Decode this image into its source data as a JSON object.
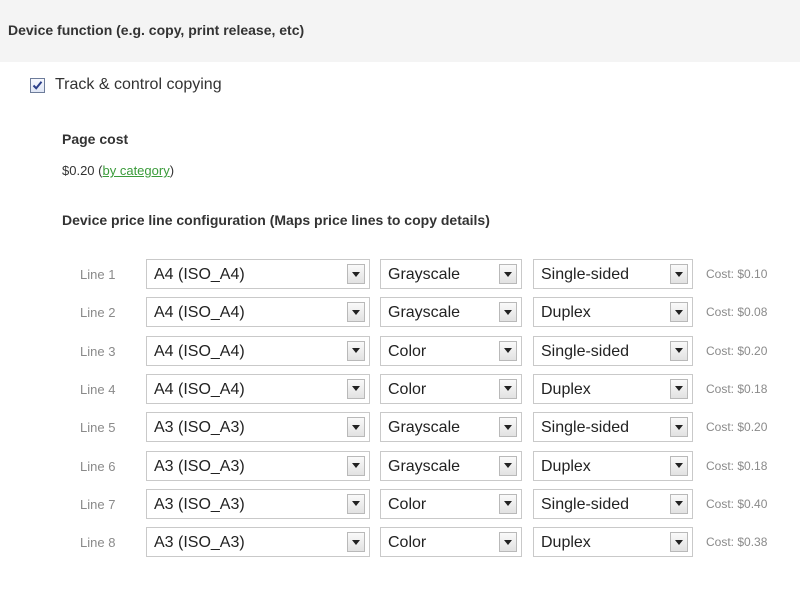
{
  "section": {
    "title": "Device function (e.g. copy, print release, etc)",
    "track_copying": {
      "label": "Track & control copying",
      "checked": true
    }
  },
  "page_cost": {
    "title": "Page cost",
    "amount": "$0.20",
    "link_label": "by category"
  },
  "price_config": {
    "title": "Device price line configuration (Maps price lines to copy details)",
    "lines": [
      {
        "label": "Line 1",
        "size": "A4 (ISO_A4)",
        "color": "Grayscale",
        "sides": "Single-sided",
        "cost": "Cost: $0.10"
      },
      {
        "label": "Line 2",
        "size": "A4 (ISO_A4)",
        "color": "Grayscale",
        "sides": "Duplex",
        "cost": "Cost: $0.08"
      },
      {
        "label": "Line 3",
        "size": "A4 (ISO_A4)",
        "color": "Color",
        "sides": "Single-sided",
        "cost": "Cost: $0.20"
      },
      {
        "label": "Line 4",
        "size": "A4 (ISO_A4)",
        "color": "Color",
        "sides": "Duplex",
        "cost": "Cost: $0.18"
      },
      {
        "label": "Line 5",
        "size": "A3 (ISO_A3)",
        "color": "Grayscale",
        "sides": "Single-sided",
        "cost": "Cost: $0.20"
      },
      {
        "label": "Line 6",
        "size": "A3 (ISO_A3)",
        "color": "Grayscale",
        "sides": "Duplex",
        "cost": "Cost: $0.18"
      },
      {
        "label": "Line 7",
        "size": "A3 (ISO_A3)",
        "color": "Color",
        "sides": "Single-sided",
        "cost": "Cost: $0.40"
      },
      {
        "label": "Line 8",
        "size": "A3 (ISO_A3)",
        "color": "Color",
        "sides": "Duplex",
        "cost": "Cost: $0.38"
      }
    ]
  },
  "colors": {
    "link": "#3a9b3a",
    "muted": "#8a8a8a",
    "header_bg": "#f4f4f4"
  }
}
